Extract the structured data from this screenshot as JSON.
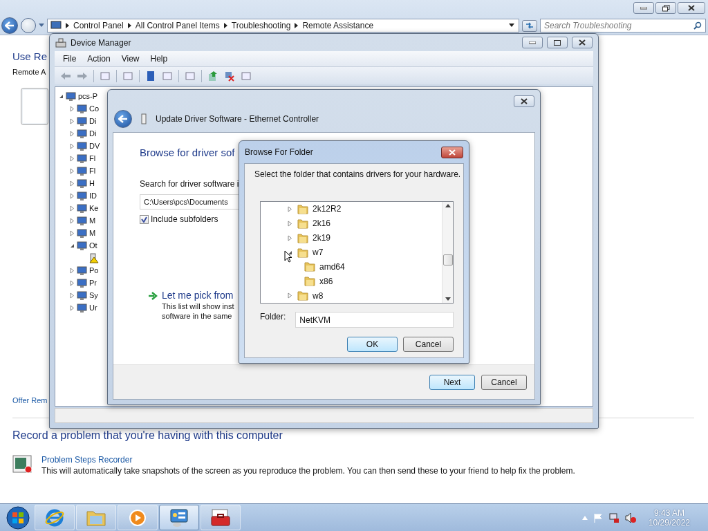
{
  "explorer": {
    "breadcrumbs": [
      "Control Panel",
      "All Control Panel Items",
      "Troubleshooting",
      "Remote Assistance"
    ],
    "search": {
      "placeholder": "Search Troubleshooting"
    },
    "heading": "Use Re",
    "subtext": "Remote A",
    "link": "Offer Rem",
    "record_heading": "Record a problem that you're having with this computer",
    "recorder": {
      "title": "Problem Steps Recorder",
      "description": "This will automatically take snapshots of the screen as you reproduce the problem. You can then send these to your friend to help fix the problem."
    }
  },
  "device_manager": {
    "title": "Device Manager",
    "menu": [
      "File",
      "Action",
      "View",
      "Help"
    ],
    "tree": [
      {
        "label": "pcs-P",
        "expanded": true,
        "children": [
          {
            "label": "Co",
            "expanded": false
          },
          {
            "label": "Di",
            "expanded": false
          },
          {
            "label": "Di",
            "expanded": false
          },
          {
            "label": "DV",
            "expanded": false
          },
          {
            "label": "Fl",
            "expanded": false
          },
          {
            "label": "Fl",
            "expanded": false
          },
          {
            "label": "H",
            "expanded": false
          },
          {
            "label": "ID",
            "expanded": false
          },
          {
            "label": "Ke",
            "expanded": false
          },
          {
            "label": "M",
            "expanded": false
          },
          {
            "label": "M",
            "expanded": false
          },
          {
            "label": "Ot",
            "expanded": true,
            "children": [
              {
                "warning": true
              }
            ]
          },
          {
            "label": "Po",
            "expanded": false
          },
          {
            "label": "Pr",
            "expanded": false
          },
          {
            "label": "Sy",
            "expanded": false
          },
          {
            "label": "Ur",
            "expanded": false
          }
        ]
      }
    ]
  },
  "update_driver": {
    "title": "Update Driver Software - Ethernet Controller",
    "heading": "Browse for driver sof",
    "search_label": "Search for driver software i",
    "path": "C:\\Users\\pcs\\Documents",
    "include_subfolders": {
      "label": "Include subfolders",
      "checked": true
    },
    "pick": {
      "title": "Let me pick from",
      "lines": [
        "This list will show inst",
        "software in the same"
      ]
    },
    "buttons": [
      "Next",
      "Cancel"
    ]
  },
  "browse_folder": {
    "title": "Browse For Folder",
    "instruction": "Select the folder that contains drivers for your hardware.",
    "tree": [
      {
        "label": "2k12R2",
        "expanded": false
      },
      {
        "label": "2k16",
        "expanded": false
      },
      {
        "label": "2k19",
        "expanded": false
      },
      {
        "label": "w7",
        "expanded": true,
        "children": [
          {
            "label": "amd64"
          },
          {
            "label": "x86"
          }
        ]
      },
      {
        "label": "w8",
        "expanded": false
      }
    ],
    "folder_label": "Folder:",
    "folder": "NetKVM",
    "buttons": [
      "OK",
      "Cancel"
    ]
  },
  "taskbar": {
    "apps": [
      {
        "kind": "browser",
        "selected": false
      },
      {
        "kind": "files",
        "selected": false
      },
      {
        "kind": "media",
        "selected": false
      },
      {
        "kind": "panel",
        "selected": true
      },
      {
        "kind": "toolbox",
        "selected": false
      }
    ],
    "time": "9:43 AM",
    "date": "10/29/2022"
  }
}
